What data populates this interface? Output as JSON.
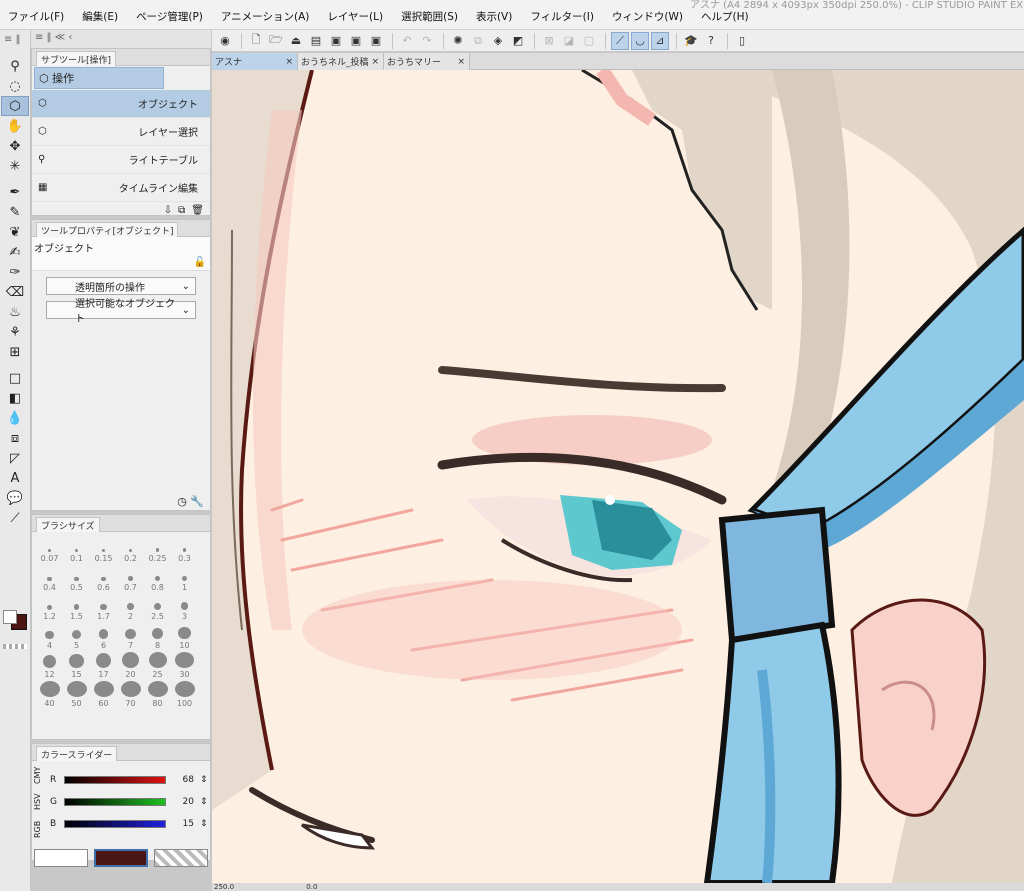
{
  "window": {
    "title": "アスナ (A4 2894 x 4093px 350dpi 250.0%) - CLIP STUDIO PAINT EX"
  },
  "menu": [
    "ファイル(F)",
    "編集(E)",
    "ページ管理(P)",
    "アニメーション(A)",
    "レイヤー(L)",
    "選択範囲(S)",
    "表示(V)",
    "フィルター(I)",
    "ウィンドウ(W)",
    "ヘルプ(H)"
  ],
  "toolstrip": {
    "header": "≡ ‖"
  },
  "panels": {
    "top_controls": "≡ ‖  ≪  ‹",
    "subtool": {
      "tab": "サブツール[操作]",
      "group": "操作",
      "items": [
        "オブジェクト",
        "レイヤー選択",
        "ライトテーブル",
        "タイムライン編集"
      ]
    },
    "tool_property": {
      "tab": "ツールプロパティ[オブジェクト]",
      "name": "オブジェクト",
      "dropdowns": [
        "透明箇所の操作",
        "選択可能なオブジェクト"
      ]
    },
    "brush_size": {
      "tab": "ブラシサイズ",
      "sizes": [
        "0.07",
        "0.1",
        "0.15",
        "0.2",
        "0.25",
        "0.3",
        "0.4",
        "0.5",
        "0.6",
        "0.7",
        "0.8",
        "1",
        "1.2",
        "1.5",
        "1.7",
        "2",
        "2.5",
        "3",
        "4",
        "5",
        "6",
        "7",
        "8",
        "10",
        "12",
        "15",
        "17",
        "20",
        "25",
        "30",
        "40",
        "50",
        "60",
        "70",
        "80",
        "100"
      ]
    },
    "color_slider": {
      "tab": "カラースライダー",
      "modes": [
        "RGB",
        "HSV",
        "CMY"
      ],
      "channels": [
        {
          "label": "R",
          "value": "68",
          "color": "#e01010"
        },
        {
          "label": "G",
          "value": "20",
          "color": "#20c020"
        },
        {
          "label": "B",
          "value": "15",
          "color": "#2020e0"
        }
      ]
    }
  },
  "colors": {
    "main": "#4a1512",
    "sub": "#ffffff",
    "accent": "#b3cbe3"
  },
  "doc_tabs": [
    "アスナ",
    "おうちネル_投稿",
    "おうちマリー"
  ],
  "status": {
    "zoom": "250.0",
    "angle": "0.0"
  }
}
